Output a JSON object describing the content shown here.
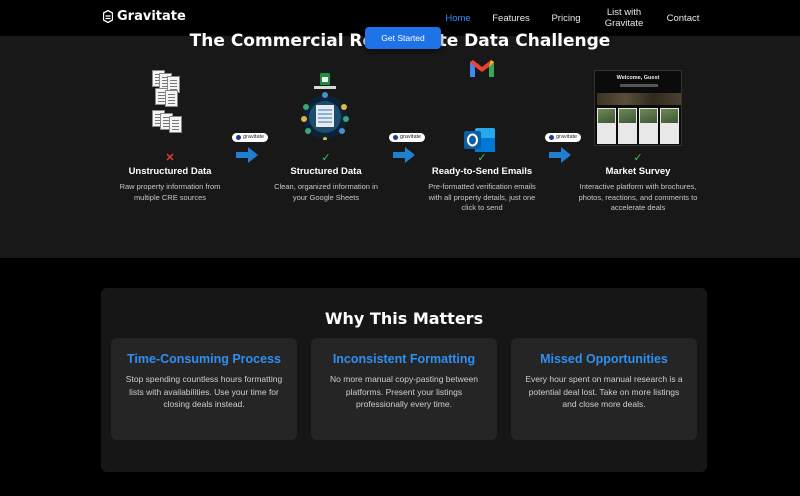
{
  "nav": {
    "brand": "Gravitate",
    "items": [
      {
        "label": "Home",
        "active": true
      },
      {
        "label": "Features",
        "active": false
      },
      {
        "label": "Pricing",
        "active": false
      },
      {
        "label": "List with Gravitate",
        "active": false
      },
      {
        "label": "Contact",
        "active": false
      }
    ]
  },
  "hero": {
    "title": "The Commercial Real Estate Data Challenge",
    "cta_label": "Get Started",
    "badge_label": "gravitate",
    "steps": [
      {
        "status": "✕",
        "title": "Unstructured Data",
        "desc": "Raw property information from multiple CRE sources"
      },
      {
        "status": "✓",
        "title": "Structured Data",
        "desc": "Clean, organized information in your Google Sheets"
      },
      {
        "status": "✓",
        "title": "Ready-to-Send Emails",
        "desc": "Pre-formatted verification emails with all property details, just one click to send"
      },
      {
        "status": "✓",
        "title": "Market Survey",
        "desc": "Interactive platform with brochures, photos, reactions, and comments to accelerate deals"
      }
    ],
    "survey_preview_title": "Welcome, Guest"
  },
  "why": {
    "title": "Why This Matters",
    "cards": [
      {
        "title": "Time-Consuming Process",
        "text": "Stop spending countless hours formatting lists with availabilities. Use your time for closing deals instead."
      },
      {
        "title": "Inconsistent Formatting",
        "text": "No more manual copy-pasting between platforms. Present your listings professionally every time."
      },
      {
        "title": "Missed Opportunities",
        "text": "Every hour spent on manual research is a potential deal lost. Take on more listings and close more deals."
      }
    ]
  },
  "colors": {
    "accent": "#2f8ff2",
    "cta": "#1e73e8",
    "check": "#39c45a",
    "cross": "#e53935",
    "flow_arrow": "#1f7fd1"
  },
  "icons": [
    "gravitate-logo-icon",
    "document-stack-icon",
    "google-sheets-icon",
    "gmail-icon",
    "outlook-icon",
    "arrow-right-icon"
  ]
}
